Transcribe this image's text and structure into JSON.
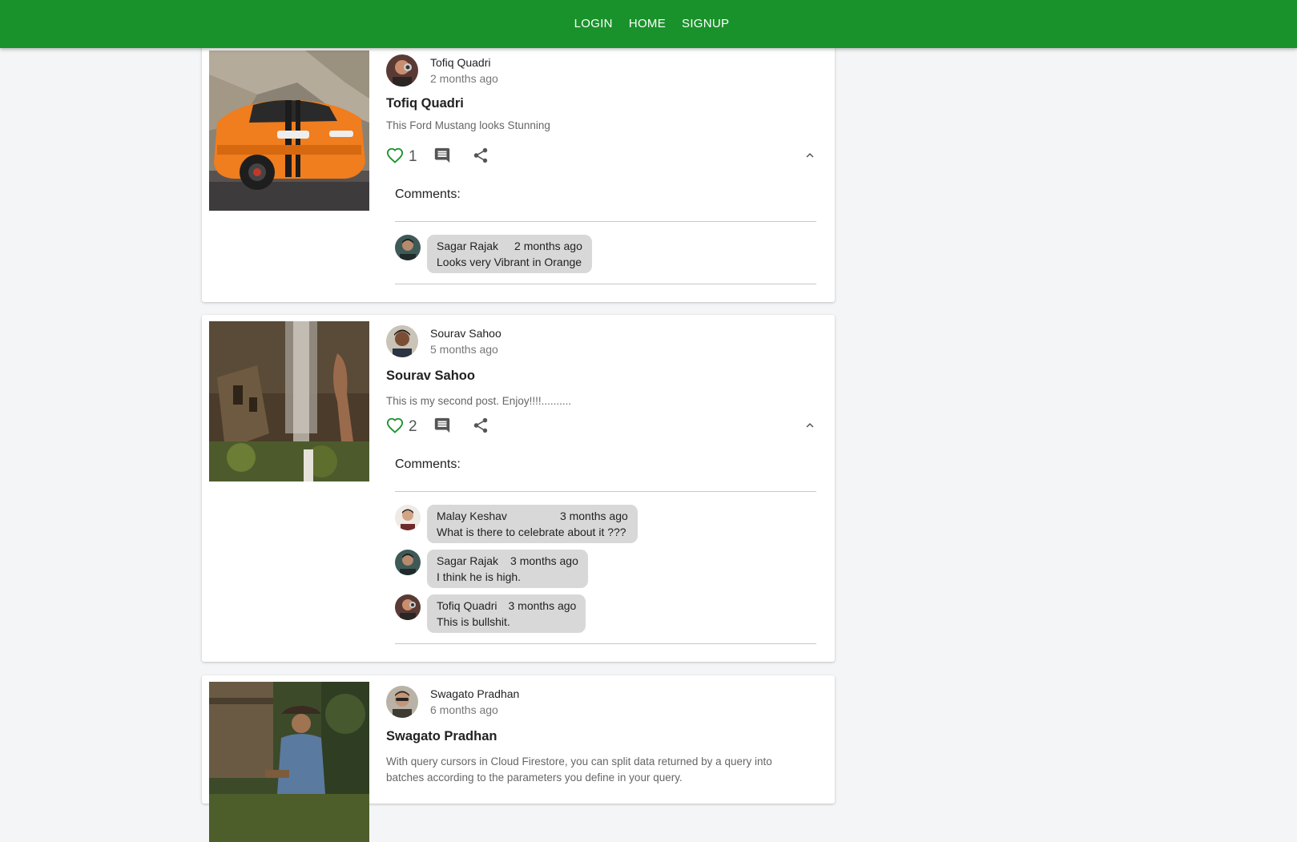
{
  "nav": {
    "login": "LOGIN",
    "home": "HOME",
    "signup": "SIGNUP"
  },
  "colors": {
    "navbar": "#1a922b",
    "like_icon": "#1a922b",
    "comment_bubble": "#d8d8d8"
  },
  "posts": [
    {
      "author": "Tofiq Quadri",
      "time": "2 months ago",
      "title": "Tofiq Quadri",
      "body": "This Ford Mustang looks Stunning",
      "likes": "1",
      "comments_label": "Comments:",
      "comments": [
        {
          "name": "Sagar Rajak",
          "time": "2 months ago",
          "text": "Looks very Vibrant in Orange"
        }
      ]
    },
    {
      "author": "Sourav Sahoo",
      "time": "5 months ago",
      "title": "Sourav Sahoo",
      "body": "This is my second post. Enjoy!!!!..........",
      "likes": "2",
      "comments_label": "Comments:",
      "comments": [
        {
          "name": "Malay Keshav",
          "time": "3 months ago",
          "text": "What is there to celebrate about it ???"
        },
        {
          "name": "Sagar Rajak",
          "time": "3 months ago",
          "text": "I think he is high."
        },
        {
          "name": "Tofiq Quadri",
          "time": "3 months ago",
          "text": "This is bullshit."
        }
      ]
    },
    {
      "author": "Swagato Pradhan",
      "time": "6 months ago",
      "title": "Swagato Pradhan",
      "body": "With query cursors in Cloud Firestore, you can split data returned by a query into batches according to the parameters you define in your query."
    }
  ],
  "icons": {
    "like": "heart-outline-icon",
    "comment": "comment-icon",
    "share": "share-icon",
    "collapse": "chevron-up-icon"
  }
}
